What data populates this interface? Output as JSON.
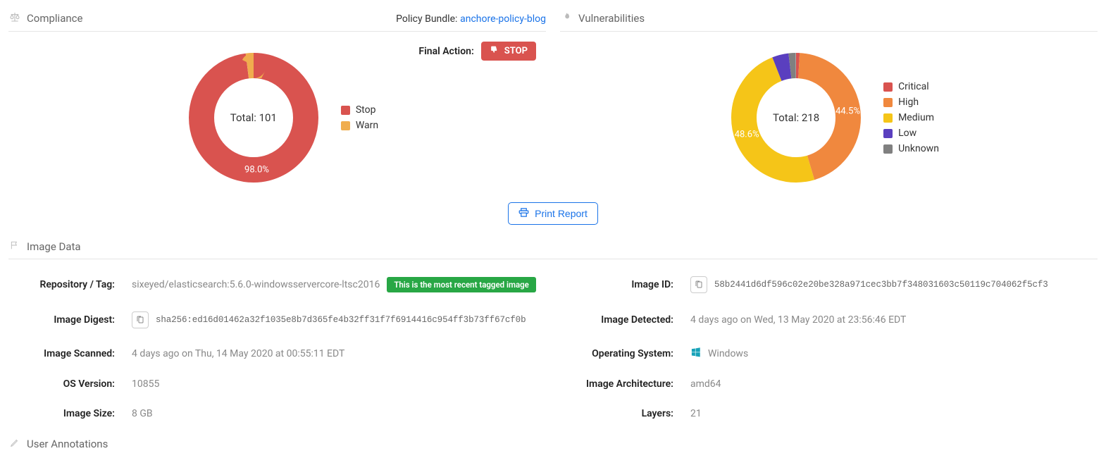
{
  "compliance": {
    "title": "Compliance",
    "bundle_label": "Policy Bundle:",
    "bundle_name": "anchore-policy-blog",
    "final_action_label": "Final Action:",
    "final_action_value": "STOP",
    "total_label": "Total: 101",
    "slice_label": "98.0%",
    "legend": [
      "Stop",
      "Warn"
    ]
  },
  "vulnerabilities": {
    "title": "Vulnerabilities",
    "total_label": "Total: 218",
    "slice_labels": {
      "high": "44.5%",
      "medium": "48.6%"
    },
    "legend": [
      "Critical",
      "High",
      "Medium",
      "Low",
      "Unknown"
    ]
  },
  "chart_data": [
    {
      "type": "pie",
      "title": "Compliance",
      "total": 101,
      "series": [
        {
          "name": "Stop",
          "value": 99,
          "pct": 98.0,
          "color": "#d9534f"
        },
        {
          "name": "Warn",
          "value": 2,
          "pct": 2.0,
          "color": "#f0ad4e"
        }
      ]
    },
    {
      "type": "pie",
      "title": "Vulnerabilities",
      "total": 218,
      "series": [
        {
          "name": "Critical",
          "value": 2,
          "pct": 0.9,
          "color": "#d9534f"
        },
        {
          "name": "High",
          "value": 97,
          "pct": 44.5,
          "color": "#f0883e"
        },
        {
          "name": "Medium",
          "value": 106,
          "pct": 48.6,
          "color": "#f5c518"
        },
        {
          "name": "Low",
          "value": 9,
          "pct": 4.1,
          "color": "#5a3fbf"
        },
        {
          "name": "Unknown",
          "value": 4,
          "pct": 1.8,
          "color": "#808080"
        }
      ]
    }
  ],
  "print_label": "Print Report",
  "image_data": {
    "title": "Image Data",
    "repo_tag_label": "Repository / Tag:",
    "repo_tag": "sixeyed/elasticsearch:5.6.0-windowsservercore-ltsc2016",
    "repo_tag_badge": "This is the most recent tagged image",
    "image_id_label": "Image ID:",
    "image_id": "58b2441d6df596c02e20be328a971cec3bb7f348031603c50119c704062f5cf3",
    "digest_label": "Image Digest:",
    "digest": "sha256:ed16d01462a32f1035e8b7d365fe4b32ff31f7f6914416c954ff3b73ff67cf0b",
    "detected_label": "Image Detected:",
    "detected": "4 days ago on Wed, 13 May 2020 at 23:56:46 EDT",
    "scanned_label": "Image Scanned:",
    "scanned": "4 days ago on Thu, 14 May 2020 at 00:55:11 EDT",
    "os_label": "Operating System:",
    "os": "Windows",
    "osver_label": "OS Version:",
    "osver": "10855",
    "arch_label": "Image Architecture:",
    "arch": "amd64",
    "size_label": "Image Size:",
    "size": "8 GB",
    "layers_label": "Layers:",
    "layers": "21"
  },
  "annotations": {
    "title": "User Annotations"
  },
  "colors": {
    "stop": "#d9534f",
    "warn": "#f0ad4e",
    "critical": "#d9534f",
    "high": "#f0883e",
    "medium": "#f5c518",
    "low": "#5a3fbf",
    "unknown": "#808080"
  }
}
